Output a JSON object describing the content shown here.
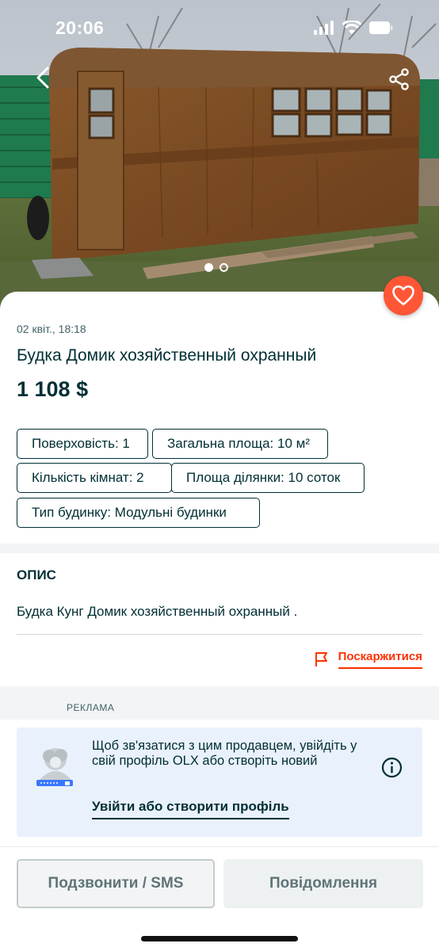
{
  "status_bar": {
    "time": "20:06",
    "icons": [
      "cellular-signal-icon",
      "wifi-icon",
      "battery-icon"
    ]
  },
  "header": {
    "back_icon": "chevron-left-icon",
    "share_icon": "share-icon"
  },
  "gallery": {
    "image_description": "rusty metal kung cabin on wooden beams",
    "page_count": 2,
    "active_page": 1
  },
  "favorite_icon": "heart-icon",
  "listing": {
    "date": "02 квіт., 18:18",
    "title": "Будка Домик хозяйственный охранный",
    "price": "1 108 $"
  },
  "parameters": [
    "Поверховість: 1",
    "Загальна площа: 10 м²",
    "Кількість кімнат: 2",
    "Площа ділянки: 10 соток",
    "Тип будинку: Модульні будинки"
  ],
  "description": {
    "heading": "ОПИС",
    "text": "Будка Кунг Домик хозяйственный охранный ."
  },
  "report": {
    "icon": "flag-icon",
    "label": "Поскаржитися"
  },
  "ad": {
    "label": "РЕКЛАМА"
  },
  "login_prompt": {
    "icon": "user-login-icon",
    "text": "Щоб зв'язатися з цим продавцем, увійдіть у свій профіль OLX або створіть новий",
    "link": "Увійти або створити профіль",
    "info_icon": "info-icon"
  },
  "actions": {
    "call": "Подзвонити / SMS",
    "message": "Повідомлення"
  },
  "colors": {
    "brand_dark": "#002f34",
    "accent_orange": "#ff5636",
    "report_red": "#ff3200",
    "card_blue": "#e9f1fd"
  }
}
